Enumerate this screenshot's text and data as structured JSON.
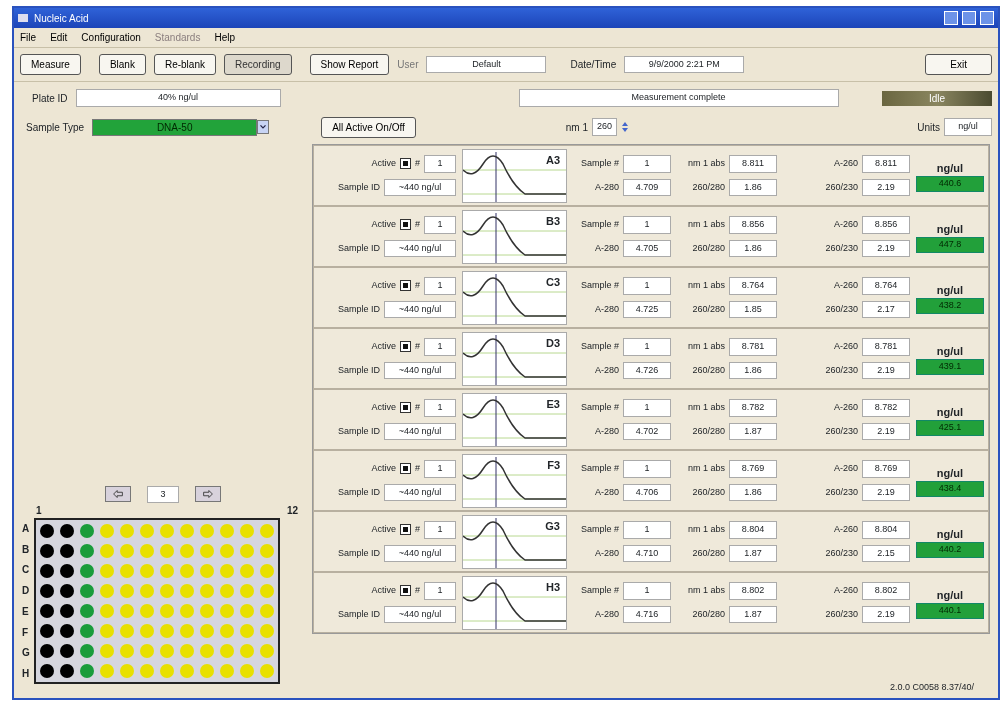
{
  "window": {
    "title": "Nucleic Acid"
  },
  "menu": [
    {
      "label": "File",
      "disabled": false
    },
    {
      "label": "Edit",
      "disabled": false
    },
    {
      "label": "Configuration",
      "disabled": false
    },
    {
      "label": "Standards",
      "disabled": true
    },
    {
      "label": "Help",
      "disabled": false
    }
  ],
  "toolbar": {
    "buttons": [
      {
        "label": "Measure",
        "pressed": false
      },
      {
        "label": "Blank",
        "pressed": false
      },
      {
        "label": "Re-blank",
        "pressed": false
      },
      {
        "label": "Recording",
        "pressed": true
      },
      {
        "label": "Show Report",
        "pressed": false
      }
    ],
    "user_label": "User",
    "user": "Default",
    "datetime_label": "Date/Time",
    "datetime": "9/9/2000 2:21 PM",
    "exit": "Exit"
  },
  "plate_id": {
    "label": "Plate ID",
    "value": "40% ng/ul"
  },
  "status_message": "Measurement complete",
  "state": "Idle",
  "sample_type": {
    "label": "Sample Type",
    "value": "DNA-50"
  },
  "all_active": "All Active On/Off",
  "nm1": {
    "label": "nm 1",
    "value": "260"
  },
  "units": {
    "label": "Units",
    "value": "ng/ul"
  },
  "plate": {
    "page": "3",
    "first_col": "1",
    "last_col": "12",
    "rows": [
      {
        "label": "A",
        "wells": [
          {
            "color": "#000000"
          },
          {
            "color": "#000000"
          },
          {
            "color": "#1a9c3a"
          },
          {
            "color": "#e8e000"
          },
          {
            "color": "#e8e000"
          },
          {
            "color": "#e8e000"
          },
          {
            "color": "#e8e000"
          },
          {
            "color": "#e8e000"
          },
          {
            "color": "#e8e000"
          },
          {
            "color": "#e8e000"
          },
          {
            "color": "#e8e000"
          },
          {
            "color": "#e8e000"
          }
        ]
      },
      {
        "label": "B",
        "wells": [
          {
            "color": "#000000"
          },
          {
            "color": "#000000"
          },
          {
            "color": "#1a9c3a"
          },
          {
            "color": "#e8e000"
          },
          {
            "color": "#e8e000"
          },
          {
            "color": "#e8e000"
          },
          {
            "color": "#e8e000"
          },
          {
            "color": "#e8e000"
          },
          {
            "color": "#e8e000"
          },
          {
            "color": "#e8e000"
          },
          {
            "color": "#e8e000"
          },
          {
            "color": "#e8e000"
          }
        ]
      },
      {
        "label": "C",
        "wells": [
          {
            "color": "#000000"
          },
          {
            "color": "#000000"
          },
          {
            "color": "#1a9c3a"
          },
          {
            "color": "#e8e000"
          },
          {
            "color": "#e8e000"
          },
          {
            "color": "#e8e000"
          },
          {
            "color": "#e8e000"
          },
          {
            "color": "#e8e000"
          },
          {
            "color": "#e8e000"
          },
          {
            "color": "#e8e000"
          },
          {
            "color": "#e8e000"
          },
          {
            "color": "#e8e000"
          }
        ]
      },
      {
        "label": "D",
        "wells": [
          {
            "color": "#000000"
          },
          {
            "color": "#000000"
          },
          {
            "color": "#1a9c3a"
          },
          {
            "color": "#e8e000"
          },
          {
            "color": "#e8e000"
          },
          {
            "color": "#e8e000"
          },
          {
            "color": "#e8e000"
          },
          {
            "color": "#e8e000"
          },
          {
            "color": "#e8e000"
          },
          {
            "color": "#e8e000"
          },
          {
            "color": "#e8e000"
          },
          {
            "color": "#e8e000"
          }
        ]
      },
      {
        "label": "E",
        "wells": [
          {
            "color": "#000000"
          },
          {
            "color": "#000000"
          },
          {
            "color": "#1a9c3a"
          },
          {
            "color": "#e8e000"
          },
          {
            "color": "#e8e000"
          },
          {
            "color": "#e8e000"
          },
          {
            "color": "#e8e000"
          },
          {
            "color": "#e8e000"
          },
          {
            "color": "#e8e000"
          },
          {
            "color": "#e8e000"
          },
          {
            "color": "#e8e000"
          },
          {
            "color": "#e8e000"
          }
        ]
      },
      {
        "label": "F",
        "wells": [
          {
            "color": "#000000"
          },
          {
            "color": "#000000"
          },
          {
            "color": "#1a9c3a"
          },
          {
            "color": "#e8e000"
          },
          {
            "color": "#e8e000"
          },
          {
            "color": "#e8e000"
          },
          {
            "color": "#e8e000"
          },
          {
            "color": "#e8e000"
          },
          {
            "color": "#e8e000"
          },
          {
            "color": "#e8e000"
          },
          {
            "color": "#e8e000"
          },
          {
            "color": "#e8e000"
          }
        ]
      },
      {
        "label": "G",
        "wells": [
          {
            "color": "#000000"
          },
          {
            "color": "#000000"
          },
          {
            "color": "#1a9c3a"
          },
          {
            "color": "#e8e000"
          },
          {
            "color": "#e8e000"
          },
          {
            "color": "#e8e000"
          },
          {
            "color": "#e8e000"
          },
          {
            "color": "#e8e000"
          },
          {
            "color": "#e8e000"
          },
          {
            "color": "#e8e000"
          },
          {
            "color": "#e8e000"
          },
          {
            "color": "#e8e000"
          }
        ]
      },
      {
        "label": "H",
        "wells": [
          {
            "color": "#000000"
          },
          {
            "color": "#000000"
          },
          {
            "color": "#1a9c3a"
          },
          {
            "color": "#e8e000"
          },
          {
            "color": "#e8e000"
          },
          {
            "color": "#e8e000"
          },
          {
            "color": "#e8e000"
          },
          {
            "color": "#e8e000"
          },
          {
            "color": "#e8e000"
          },
          {
            "color": "#e8e000"
          },
          {
            "color": "#e8e000"
          },
          {
            "color": "#e8e000"
          }
        ]
      }
    ]
  },
  "samples": [
    {
      "well": "A3",
      "active_label": "Active",
      "active": true,
      "number_label": "#",
      "number": "1",
      "sample_id_label": "Sample ID",
      "sample_id": "~440 ng/ul",
      "sample_no_label": "Sample #",
      "sample_no": "1",
      "abs_label": "nm 1 abs",
      "abs": "8.811",
      "a280_label": "A-280",
      "a280": "4.709",
      "ratio280_label": "260/280",
      "ratio280": "1.86",
      "a260_label": "A-260",
      "a260": "8.811",
      "ratio230_label": "260/230",
      "ratio230": "2.19",
      "unit": "ng/ul",
      "conc": "440.6"
    },
    {
      "well": "B3",
      "active_label": "Active",
      "active": true,
      "number_label": "#",
      "number": "1",
      "sample_id_label": "Sample ID",
      "sample_id": "~440 ng/ul",
      "sample_no_label": "Sample #",
      "sample_no": "1",
      "abs_label": "nm 1 abs",
      "abs": "8.856",
      "a280_label": "A-280",
      "a280": "4.705",
      "ratio280_label": "260/280",
      "ratio280": "1.86",
      "a260_label": "A-260",
      "a260": "8.856",
      "ratio230_label": "260/230",
      "ratio230": "2.19",
      "unit": "ng/ul",
      "conc": "447.8"
    },
    {
      "well": "C3",
      "active_label": "Active",
      "active": true,
      "number_label": "#",
      "number": "1",
      "sample_id_label": "Sample ID",
      "sample_id": "~440 ng/ul",
      "sample_no_label": "Sample #",
      "sample_no": "1",
      "abs_label": "nm 1 abs",
      "abs": "8.764",
      "a280_label": "A-280",
      "a280": "4.725",
      "ratio280_label": "260/280",
      "ratio280": "1.85",
      "a260_label": "A-260",
      "a260": "8.764",
      "ratio230_label": "260/230",
      "ratio230": "2.17",
      "unit": "ng/ul",
      "conc": "438.2"
    },
    {
      "well": "D3",
      "active_label": "Active",
      "active": true,
      "number_label": "#",
      "number": "1",
      "sample_id_label": "Sample ID",
      "sample_id": "~440 ng/ul",
      "sample_no_label": "Sample #",
      "sample_no": "1",
      "abs_label": "nm 1 abs",
      "abs": "8.781",
      "a280_label": "A-280",
      "a280": "4.726",
      "ratio280_label": "260/280",
      "ratio280": "1.86",
      "a260_label": "A-260",
      "a260": "8.781",
      "ratio230_label": "260/230",
      "ratio230": "2.19",
      "unit": "ng/ul",
      "conc": "439.1"
    },
    {
      "well": "E3",
      "active_label": "Active",
      "active": true,
      "number_label": "#",
      "number": "1",
      "sample_id_label": "Sample ID",
      "sample_id": "~440 ng/ul",
      "sample_no_label": "Sample #",
      "sample_no": "1",
      "abs_label": "nm 1 abs",
      "abs": "8.782",
      "a280_label": "A-280",
      "a280": "4.702",
      "ratio280_label": "260/280",
      "ratio280": "1.87",
      "a260_label": "A-260",
      "a260": "8.782",
      "ratio230_label": "260/230",
      "ratio230": "2.19",
      "unit": "ng/ul",
      "conc": "425.1"
    },
    {
      "well": "F3",
      "active_label": "Active",
      "active": true,
      "number_label": "#",
      "number": "1",
      "sample_id_label": "Sample ID",
      "sample_id": "~440 ng/ul",
      "sample_no_label": "Sample #",
      "sample_no": "1",
      "abs_label": "nm 1 abs",
      "abs": "8.769",
      "a280_label": "A-280",
      "a280": "4.706",
      "ratio280_label": "260/280",
      "ratio280": "1.86",
      "a260_label": "A-260",
      "a260": "8.769",
      "ratio230_label": "260/230",
      "ratio230": "2.19",
      "unit": "ng/ul",
      "conc": "438.4"
    },
    {
      "well": "G3",
      "active_label": "Active",
      "active": true,
      "number_label": "#",
      "number": "1",
      "sample_id_label": "Sample ID",
      "sample_id": "~440 ng/ul",
      "sample_no_label": "Sample #",
      "sample_no": "1",
      "abs_label": "nm 1 abs",
      "abs": "8.804",
      "a280_label": "A-280",
      "a280": "4.710",
      "ratio280_label": "260/280",
      "ratio280": "1.87",
      "a260_label": "A-260",
      "a260": "8.804",
      "ratio230_label": "260/230",
      "ratio230": "2.15",
      "unit": "ng/ul",
      "conc": "440.2"
    },
    {
      "well": "H3",
      "active_label": "Active",
      "active": true,
      "number_label": "#",
      "number": "1",
      "sample_id_label": "Sample ID",
      "sample_id": "~440 ng/ul",
      "sample_no_label": "Sample #",
      "sample_no": "1",
      "abs_label": "nm 1 abs",
      "abs": "8.802",
      "a280_label": "A-280",
      "a280": "4.716",
      "ratio280_label": "260/280",
      "ratio280": "1.87",
      "a260_label": "A-260",
      "a260": "8.802",
      "ratio230_label": "260/230",
      "ratio230": "2.19",
      "unit": "ng/ul",
      "conc": "440.1"
    }
  ],
  "version": "2.0.0 C0058 8.37/40/"
}
